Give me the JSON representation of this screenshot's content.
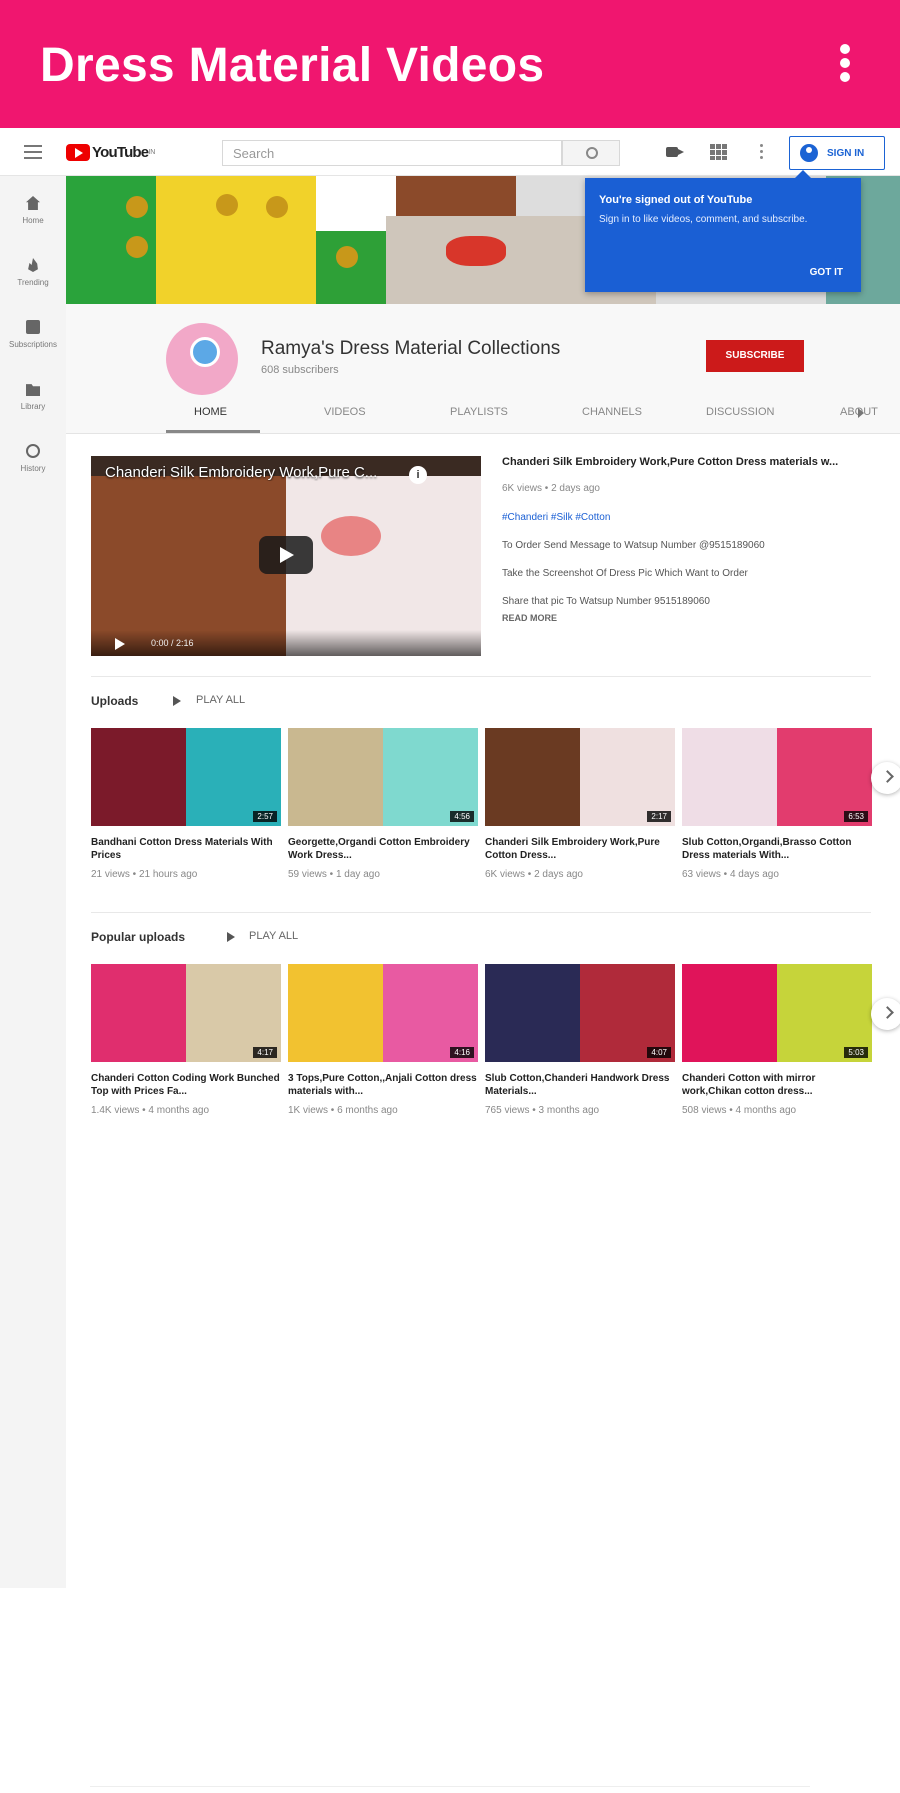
{
  "appbar": {
    "title": "Dress Material Videos"
  },
  "header": {
    "logo_text": "YouTube",
    "logo_sup": "IN",
    "search_placeholder": "Search",
    "signin_label": "SIGN IN"
  },
  "sidebar": {
    "items": [
      {
        "label": "Home",
        "icon": "home-icon"
      },
      {
        "label": "Trending",
        "icon": "trending-icon"
      },
      {
        "label": "Subscriptions",
        "icon": "subscriptions-icon"
      },
      {
        "label": "Library",
        "icon": "library-icon"
      },
      {
        "label": "History",
        "icon": "history-icon"
      }
    ]
  },
  "tooltip": {
    "title": "You're signed out of YouTube",
    "body": "Sign in to like videos, comment, and subscribe.",
    "button": "GOT IT"
  },
  "channel": {
    "name": "Ramya's Dress Material Collections",
    "subscribers": "608 subscribers",
    "subscribe_label": "SUBSCRIBE",
    "tabs": [
      "HOME",
      "VIDEOS",
      "PLAYLISTS",
      "CHANNELS",
      "DISCUSSION",
      "ABOUT"
    ],
    "active_tab": "HOME"
  },
  "featured": {
    "overlay_title": "Chanderi Silk Embroidery Work,Pure C...",
    "time": "0:00 / 2:16",
    "title": "Chanderi Silk Embroidery Work,Pure Cotton Dress materials w...",
    "meta": "6K views • 2 days ago",
    "hashtags": "#Chanderi #Silk #Cotton",
    "desc1": "To Order Send Message to Watsup Number @9515189060",
    "desc2": "Take the Screenshot Of Dress Pic Which Want to Order",
    "desc3": "Share that pic To Watsup Number 9515189060",
    "read_more": "READ MORE"
  },
  "uploads": {
    "title": "Uploads",
    "play_all": "PLAY ALL",
    "videos": [
      {
        "title": "Bandhani Cotton Dress Materials With Prices",
        "meta": "21 views • 21 hours ago",
        "duration": "2:57",
        "colors": [
          "#7b1a2a",
          "#2ab0b8"
        ]
      },
      {
        "title": "Georgette,Organdi Cotton Embroidery Work Dress...",
        "meta": "59 views • 1 day ago",
        "duration": "4:56",
        "colors": [
          "#c9b890",
          "#7fd9cf"
        ]
      },
      {
        "title": "Chanderi Silk Embroidery Work,Pure Cotton Dress...",
        "meta": "6K views • 2 days ago",
        "duration": "2:17",
        "colors": [
          "#6a3a22",
          "#efe0e0"
        ]
      },
      {
        "title": "Slub Cotton,Organdi,Brasso Cotton Dress materials With...",
        "meta": "63 views • 4 days ago",
        "duration": "6:53",
        "colors": [
          "#efdde6",
          "#e23c6e"
        ]
      }
    ]
  },
  "popular": {
    "title": "Popular uploads",
    "play_all": "PLAY ALL",
    "videos": [
      {
        "title": "Chanderi Cotton Coding Work Bunched Top with Prices Fa...",
        "meta": "1.4K views • 4 months ago",
        "duration": "4:17",
        "colors": [
          "#e02e6e",
          "#d9c9a8"
        ]
      },
      {
        "title": "3 Tops,Pure Cotton,,Anjali Cotton dress materials with...",
        "meta": "1K views • 6 months ago",
        "duration": "4:16",
        "colors": [
          "#f2c230",
          "#e85aa2"
        ]
      },
      {
        "title": "Slub Cotton,Chanderi Handwork Dress Materials...",
        "meta": "765 views • 3 months ago",
        "duration": "4:07",
        "colors": [
          "#2a2a55",
          "#b02a3a"
        ]
      },
      {
        "title": "Chanderi Cotton with mirror work,Chikan cotton dress...",
        "meta": "508 views • 4 months ago",
        "duration": "5:03",
        "colors": [
          "#e0145a",
          "#c6d43a"
        ]
      }
    ]
  }
}
